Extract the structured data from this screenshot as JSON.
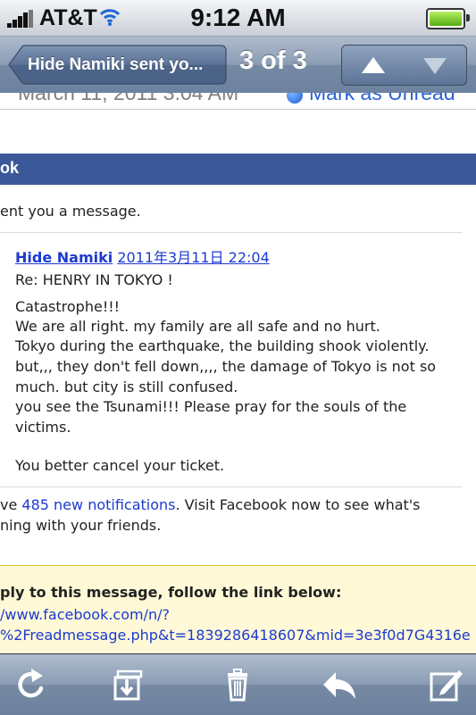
{
  "status_bar": {
    "carrier": "AT&T",
    "time": "9:12 AM"
  },
  "nav": {
    "back_label": "Hide Namiki sent yo...",
    "counter": "3 of 3"
  },
  "message_header": {
    "date": "March 11, 2011 3:04 AM",
    "mark_unread": "Mark as Unread"
  },
  "email": {
    "fb_band_text": "ok",
    "sent_line": "ent you a message.",
    "sender": "Hide Namiki",
    "timestamp": "2011年3月11日  22:04",
    "subject": "Re: HENRY IN TOKYO !",
    "body_lines": [
      "Catastrophe!!!",
      "We are all right. my family are all safe and no hurt.",
      "Tokyo during the earthquake, the building shook violently.",
      "but,,, they don't fell down,,,, the damage of Tokyo is not so",
      "much. but city is still confused.",
      "you see the Tsunami!!! Please pray for the souls of the",
      "victims.",
      "",
      "You better cancel your ticket."
    ],
    "notif_prefix": "ve ",
    "notif_link": "485 new notifications",
    "notif_suffix": ". Visit Facebook now to see what's",
    "notif_line2": "ning with your friends.",
    "reply_heading": "ply to this message, follow the link below:",
    "reply_link_1": "/www.facebook.com/n/?",
    "reply_link_2": "%2Freadmessage.php&t=1839286418607&mid=3e3f0d7G4316e"
  },
  "toolbar": {
    "items": [
      "refresh-icon",
      "move-folder-icon",
      "trash-icon",
      "reply-icon",
      "compose-icon"
    ]
  },
  "colors": {
    "facebook_blue": "#3b5998",
    "link_blue": "#1c3ad1",
    "reply_box_bg": "#fff9d7"
  }
}
